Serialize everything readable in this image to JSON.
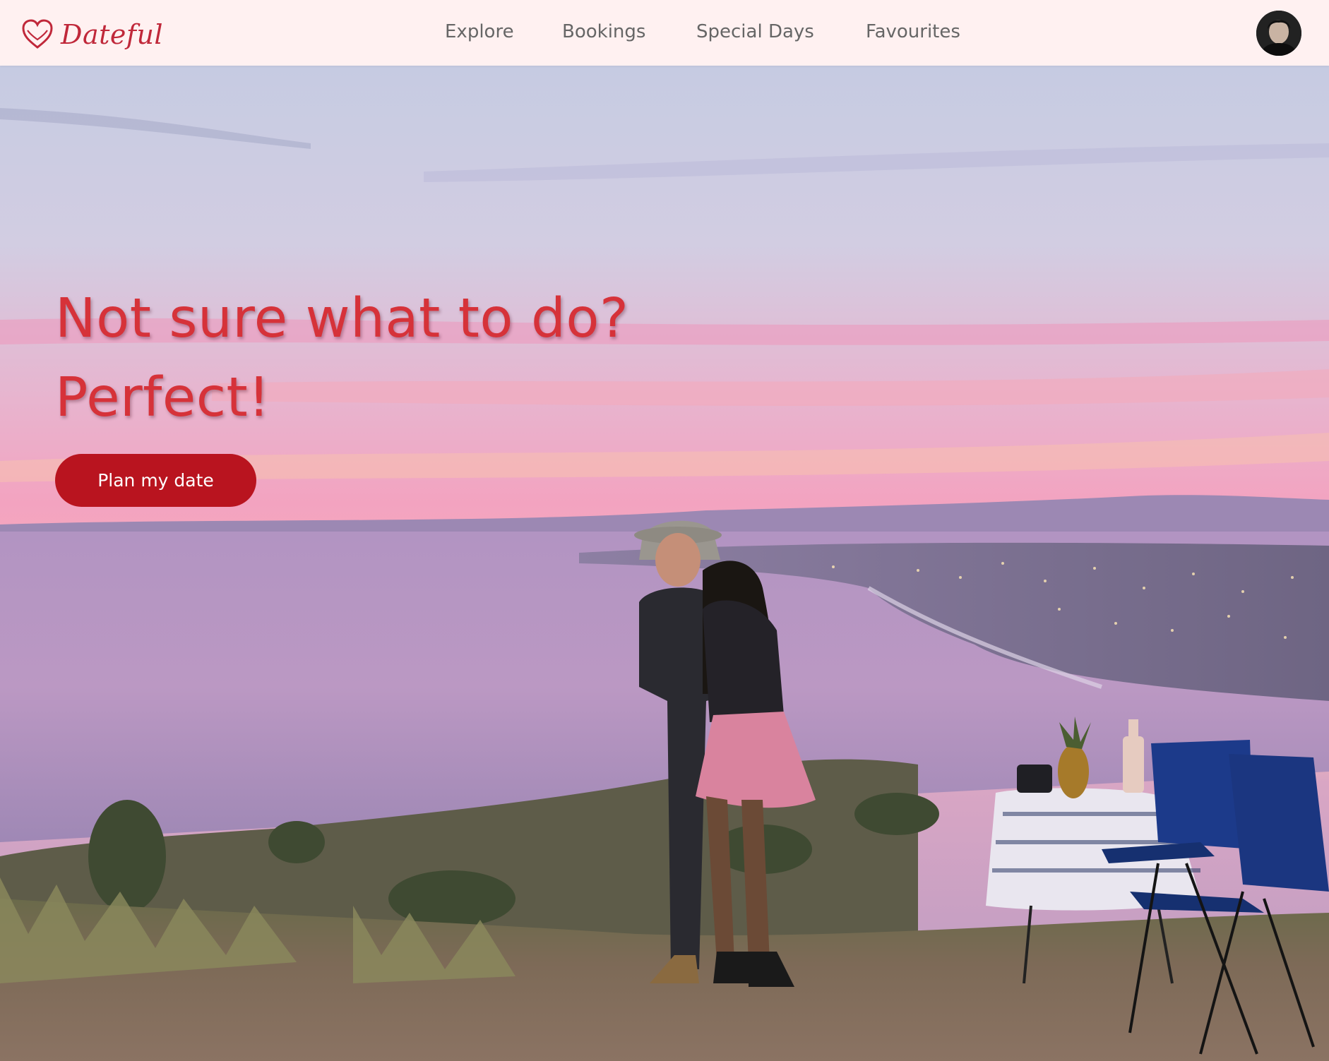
{
  "brand": {
    "name": "Dateful",
    "color": "#c0283a"
  },
  "nav": {
    "links": [
      {
        "label": "Explore"
      },
      {
        "label": "Bookings"
      },
      {
        "label": "Special Days"
      },
      {
        "label": "Favourites"
      }
    ]
  },
  "user": {
    "avatar_icon": "user-avatar"
  },
  "hero": {
    "headline_line1": "Not sure what to do?",
    "headline_line2": "Perfect!",
    "cta_label": "Plan my date",
    "headline_color": "#d63239",
    "cta_color": "#b9141f"
  }
}
